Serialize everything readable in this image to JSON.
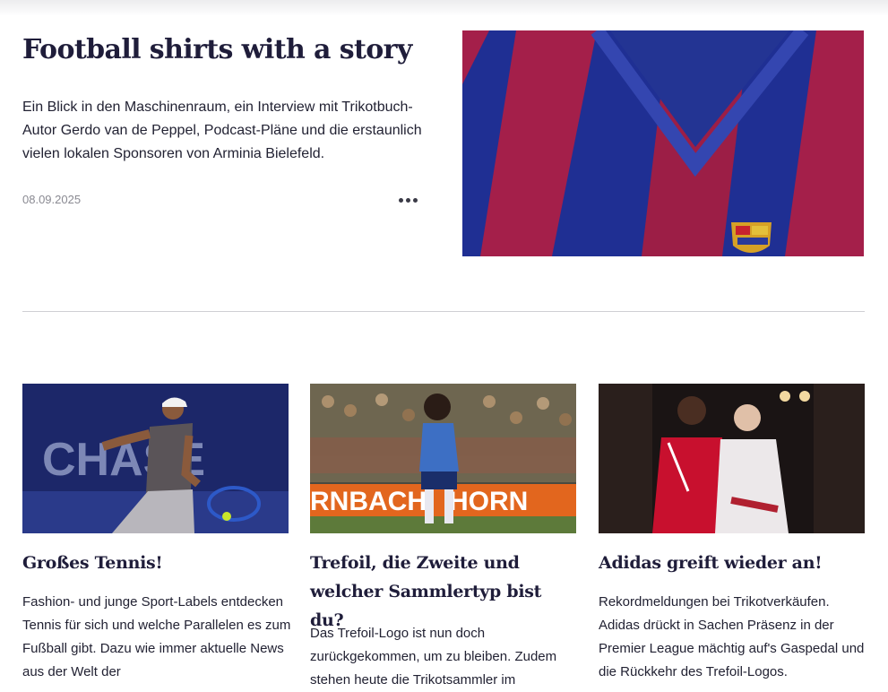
{
  "feature": {
    "title": "Football shirts with a story",
    "teaser": "Ein Blick in den Maschinenraum, ein Interview mit Trikotbuch-Autor Gerdo van de Peppel, Podcast-Pläne und die erstaunlich vielen lokalen Sponsoren von Arminia Bielefeld.",
    "date": "08.09.2025",
    "image_icon": "barcelona-shirt-photo"
  },
  "cards": [
    {
      "title": "Großes Tennis!",
      "text": "Fashion- und junge Sport-Labels entdecken Tennis für sich und welche Parallelen es zum Fußball gibt. Dazu wie immer aktuelle News aus der Welt der",
      "image_icon": "tennis-player-photo",
      "image_text": "CHASE"
    },
    {
      "title": "Trefoil, die Zweite und welcher Sammlertyp bist du?",
      "text": "Das Trefoil-Logo ist nun doch zurückgekommen, um zu bleiben. Zudem stehen heute die Trikotsammler im",
      "image_icon": "football-player-photo",
      "image_text": "RNBACH   HORN"
    },
    {
      "title": "Adidas greift wieder an!",
      "text": "Rekordmeldungen bei Trikotverkäufen. Adidas drückt in Sachen Präsenz in der Premier League mächtig auf's Gaspedal und die Rückkehr des Trefoil-Logos.",
      "image_icon": "liverpool-kit-photo"
    }
  ],
  "colors": {
    "barca_blue": "#1f2f93",
    "barca_red": "#a41f4a",
    "liverpool_red": "#c8102e"
  }
}
